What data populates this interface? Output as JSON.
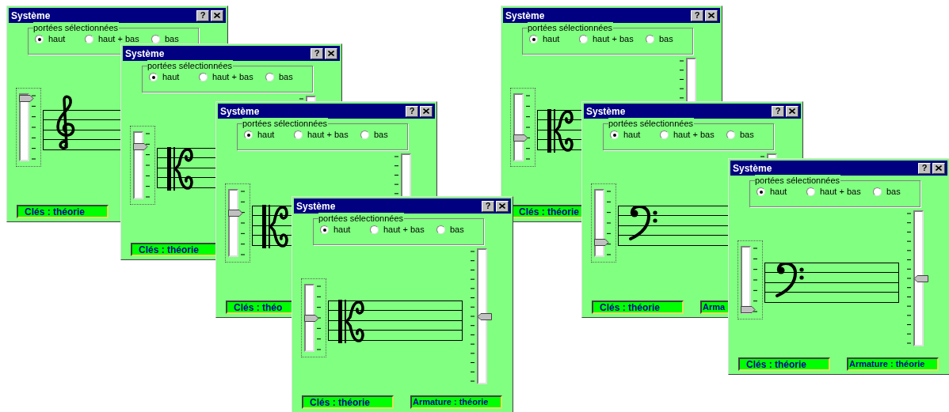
{
  "windows": [
    {
      "title": "Système",
      "help_button": "?",
      "group": {
        "legend": "portées sélectionnées",
        "options": [
          {
            "label": "haut",
            "selected": true
          },
          {
            "label": "haut + bas",
            "selected": false
          },
          {
            "label": "bas",
            "selected": false
          }
        ]
      },
      "left_slider": {
        "level": 1
      },
      "clef": {
        "kind": "treble"
      },
      "buttons": [
        {
          "label": "Clés : théorie"
        }
      ]
    },
    {
      "title": "Système",
      "help_button": "?",
      "group": {
        "legend": "portées sélectionnées",
        "options": [
          {
            "label": "haut",
            "selected": true
          },
          {
            "label": "haut + bas",
            "selected": false
          },
          {
            "label": "bas",
            "selected": false
          }
        ]
      },
      "left_slider": {
        "level": 0.83
      },
      "clef": {
        "kind": "c"
      },
      "right_slider": {
        "kind": "partial"
      },
      "buttons": [
        {
          "label": "Clés : théorie"
        }
      ]
    },
    {
      "title": "Système",
      "help_button": "?",
      "group": {
        "legend": "portées sélectionnées",
        "options": [
          {
            "label": "haut",
            "selected": true
          },
          {
            "label": "haut + bas",
            "selected": false
          },
          {
            "label": "bas",
            "selected": false
          }
        ]
      },
      "left_slider": {
        "level": 0.67
      },
      "clef": {
        "kind": "c"
      },
      "right_slider": {
        "kind": "partial"
      },
      "buttons": [
        {
          "label": "Clés : théo"
        }
      ]
    },
    {
      "title": "Système",
      "help_button": "?",
      "group": {
        "legend": "portées sélectionnées",
        "options": [
          {
            "label": "haut",
            "selected": true
          },
          {
            "label": "haut + bas",
            "selected": false
          },
          {
            "label": "bas",
            "selected": false
          }
        ]
      },
      "left_slider": {
        "level": 0.5
      },
      "clef": {
        "kind": "c"
      },
      "right_slider": {
        "kind": "full",
        "level": 0.5
      },
      "buttons": [
        {
          "label": "Clés : théorie"
        },
        {
          "label": "Armature : théorie"
        }
      ]
    },
    {
      "title": "Système",
      "help_button": "?",
      "group": {
        "legend": "portées sélectionnées",
        "options": [
          {
            "label": "haut",
            "selected": true
          },
          {
            "label": "haut + bas",
            "selected": false
          },
          {
            "label": "bas",
            "selected": false
          }
        ]
      },
      "left_slider": {
        "level": 0.33
      },
      "clef": {
        "kind": "c"
      },
      "right_slider": {
        "kind": "partial"
      },
      "buttons": [
        {
          "label": "Clés : théorie"
        }
      ]
    },
    {
      "title": "Système",
      "help_button": "?",
      "group": {
        "legend": "portées sélectionnées",
        "options": [
          {
            "label": "haut",
            "selected": true
          },
          {
            "label": "haut + bas",
            "selected": false
          },
          {
            "label": "bas",
            "selected": false
          }
        ]
      },
      "left_slider": {
        "level": 0.17
      },
      "clef": {
        "kind": "bass"
      },
      "right_slider": {
        "kind": "partial"
      },
      "buttons": [
        {
          "label": "Clés : théorie"
        },
        {
          "label": "Arma"
        }
      ]
    },
    {
      "title": "Système",
      "help_button": "?",
      "group": {
        "legend": "portées sélectionnées",
        "options": [
          {
            "label": "haut",
            "selected": true
          },
          {
            "label": "haut + bas",
            "selected": false
          },
          {
            "label": "bas",
            "selected": false
          }
        ]
      },
      "left_slider": {
        "level": 0
      },
      "clef": {
        "kind": "bass"
      },
      "right_slider": {
        "kind": "full",
        "level": 0.5
      },
      "buttons": [
        {
          "label": "Clés : théorie"
        },
        {
          "label": "Armature : théorie"
        }
      ]
    }
  ]
}
